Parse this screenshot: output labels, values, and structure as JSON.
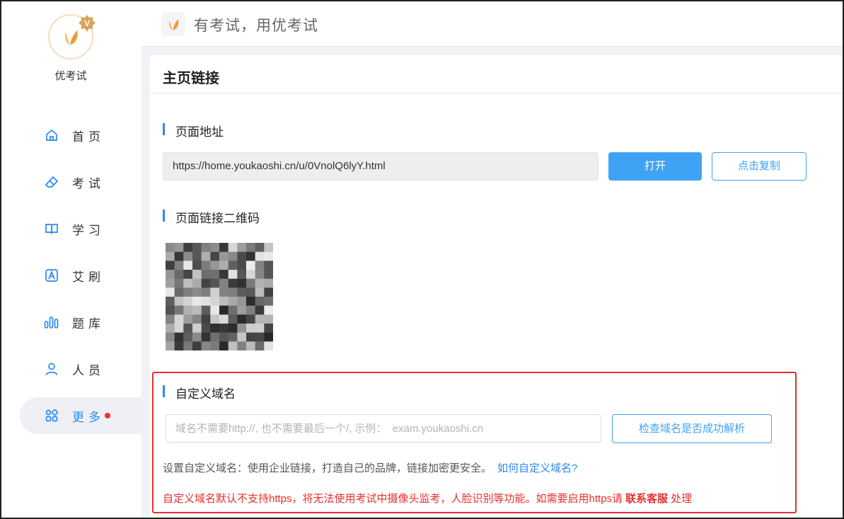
{
  "brand": {
    "name": "优考试",
    "badge": "V"
  },
  "nav": {
    "items": [
      {
        "label": "首页",
        "icon": "home-icon"
      },
      {
        "label": "考试",
        "icon": "eraser-icon"
      },
      {
        "label": "学习",
        "icon": "book-icon"
      },
      {
        "label": "艾刷",
        "icon": "letter-a-icon"
      },
      {
        "label": "题库",
        "icon": "bar-chart-icon"
      },
      {
        "label": "人员",
        "icon": "user-icon"
      },
      {
        "label": "更多",
        "icon": "apps-icon",
        "active": true,
        "has_dot": true
      }
    ]
  },
  "header": {
    "slogan": "有考试，用优考试"
  },
  "card": {
    "title": "主页链接",
    "page_url": {
      "section_title": "页面地址",
      "value": "https://home.youkaoshi.cn/u/0VnolQ6lyY.html",
      "open_label": "打开",
      "copy_label": "点击复制"
    },
    "qr": {
      "section_title": "页面链接二维码"
    },
    "custom_domain": {
      "section_title": "自定义域名",
      "placeholder": "域名不需要http://, 也不需要最后一个/, 示例：  exam.youkaoshi.cn",
      "check_label": "检查域名是否成功解析",
      "description": "设置自定义域名：使用企业链接，打造自己的品牌，链接加密更安全。",
      "help_link": "如何自定义域名?",
      "warning_prefix": "自定义域名默认不支持https，将无法使用考试中摄像头监考，人脸识别等功能。如需要启用https请",
      "warning_contact": "联系客服",
      "warning_suffix": "处理"
    }
  },
  "colors": {
    "accent": "#3fa3f5",
    "warning": "#e53030",
    "brand_orange": "#f5a347"
  }
}
